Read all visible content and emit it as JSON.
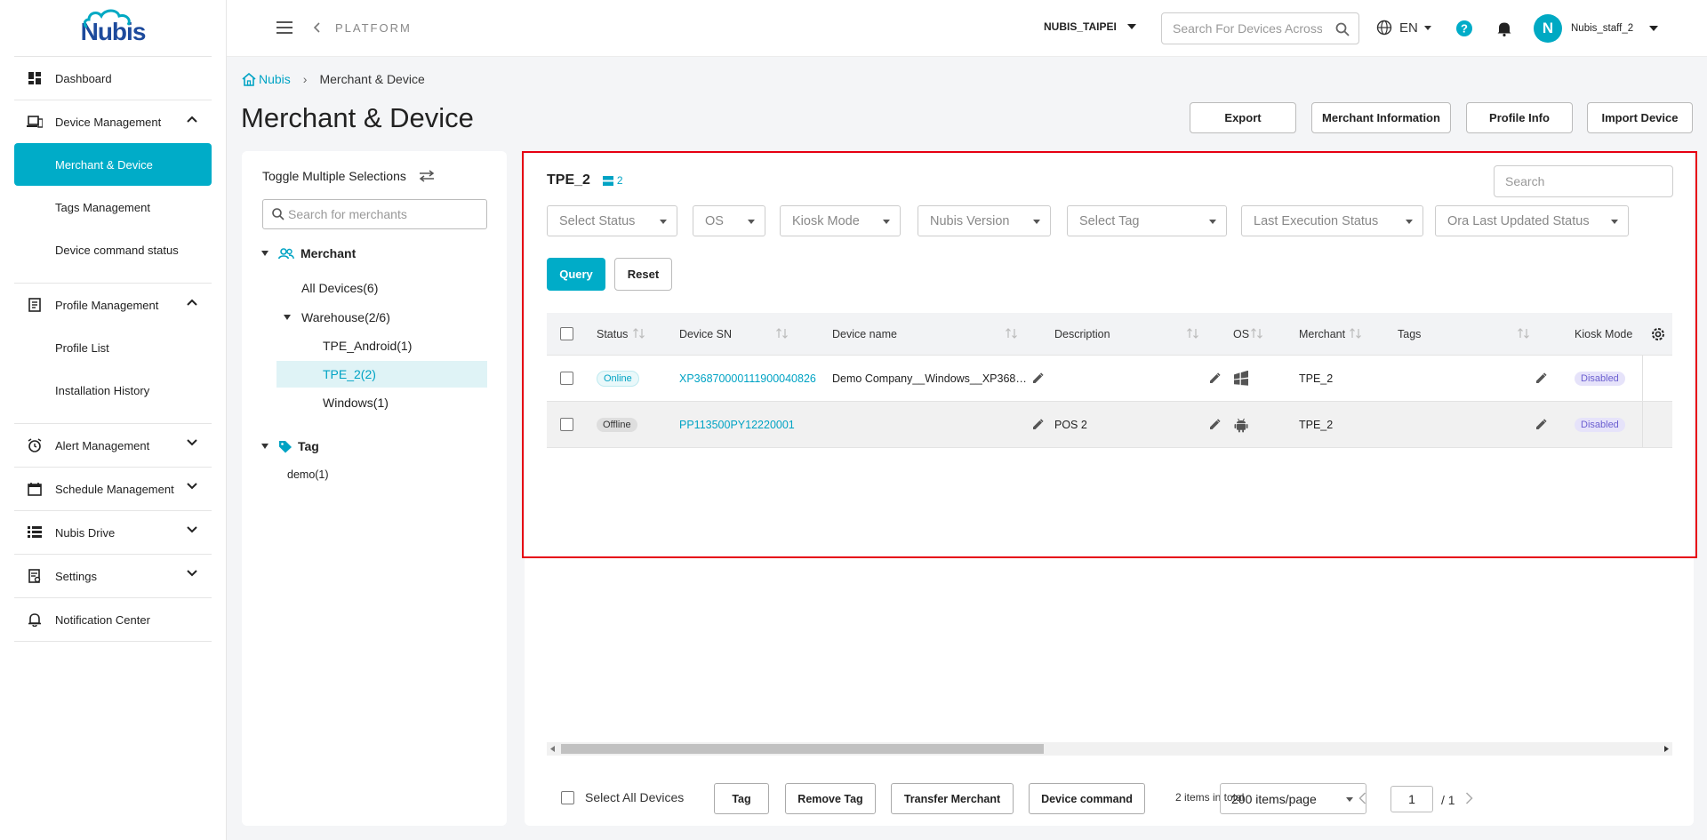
{
  "app": {
    "logo_text": "Nubis"
  },
  "sidebar": {
    "items": [
      {
        "label": "Dashboard",
        "icon": "dashboard-icon"
      },
      {
        "label": "Device Management",
        "icon": "devices-icon"
      },
      {
        "label": "Merchant & Device"
      },
      {
        "label": "Tags Management"
      },
      {
        "label": "Device command status"
      },
      {
        "label": "Profile Management",
        "icon": "profile-icon"
      },
      {
        "label": "Profile List"
      },
      {
        "label": "Installation History"
      },
      {
        "label": "Alert Management",
        "icon": "alarm-icon"
      },
      {
        "label": "Schedule Management",
        "icon": "calendar-icon"
      },
      {
        "label": "Nubis Drive",
        "icon": "storage-icon"
      },
      {
        "label": "Settings",
        "icon": "settings-icon"
      },
      {
        "label": "Notification Center",
        "icon": "bell-icon"
      }
    ]
  },
  "topbar": {
    "platform": "PLATFORM",
    "tenant": "NUBIS_TAIPEI",
    "search_placeholder": "Search For Devices Across",
    "language": "EN",
    "avatar_initial": "N",
    "username": "Nubis_staff_2"
  },
  "breadcrumb": {
    "home": "Nubis",
    "current": "Merchant & Device"
  },
  "page_title": "Merchant & Device",
  "header_buttons": {
    "export": "Export",
    "merchant_info": "Merchant Information",
    "profile_info": "Profile Info",
    "import_device": "Import Device"
  },
  "left_panel": {
    "toggle_label": "Toggle Multiple Selections",
    "search_placeholder": "Search for merchants",
    "merchant_heading": "Merchant",
    "all_devices": "All Devices(6)",
    "warehouse": "Warehouse(2/6)",
    "children": [
      "TPE_Android(1)",
      "TPE_2(2)",
      "Windows(1)"
    ],
    "tag_heading": "Tag",
    "tags": [
      "demo(1)"
    ]
  },
  "main": {
    "title": "TPE_2",
    "count": "2",
    "search_placeholder": "Search",
    "filters": [
      "Select Status",
      "OS",
      "Kiosk Mode",
      "Nubis Version",
      "Select Tag",
      "Last Execution Status",
      "Ora Last Updated Status"
    ],
    "query_label": "Query",
    "reset_label": "Reset",
    "columns": {
      "status": "Status",
      "sn": "Device SN",
      "name": "Device name",
      "description": "Description",
      "os": "OS",
      "merchant": "Merchant",
      "tags": "Tags",
      "kiosk": "Kiosk Mode"
    },
    "rows": [
      {
        "status": "Online",
        "sn": "XP36870000111900040826",
        "name": "Demo Company__Windows__XP368…",
        "description": "",
        "os": "windows-icon",
        "merchant": "TPE_2",
        "tags": "",
        "kiosk": "Disabled"
      },
      {
        "status": "Offline",
        "sn": "PP113500PY12220001",
        "name": "",
        "description": "POS 2",
        "os": "android-icon",
        "merchant": "TPE_2",
        "tags": "",
        "kiosk": "Disabled"
      }
    ]
  },
  "footer": {
    "select_all": "Select All Devices",
    "tag": "Tag",
    "remove_tag": "Remove Tag",
    "transfer": "Transfer Merchant",
    "command": "Device command",
    "total": "2 items in total",
    "page_size": "200 items/page",
    "page": "1",
    "page_total": "/ 1"
  },
  "colors": {
    "accent": "#00acc8",
    "highlight": "#e60012",
    "kiosk_badge": "#6b5fd0"
  }
}
